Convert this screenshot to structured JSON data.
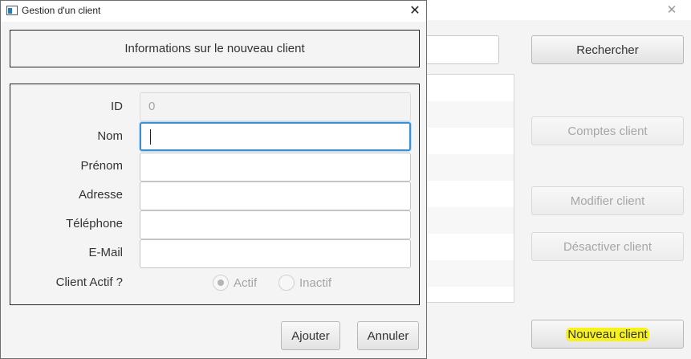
{
  "main_window": {
    "buttons": {
      "search": "Rechercher",
      "accounts": "Comptes client",
      "modify": "Modifier client",
      "deactivate": "Désactiver client",
      "new_client": "Nouveau client"
    },
    "close_icon": "✕"
  },
  "dialog": {
    "title": "Gestion d'un client",
    "close_icon": "✕",
    "header": "Informations sur le nouveau client",
    "fields": {
      "id_label": "ID",
      "id_value": "0",
      "nom_label": "Nom",
      "nom_value": "",
      "prenom_label": "Prénom",
      "prenom_value": "",
      "adresse_label": "Adresse",
      "adresse_value": "",
      "telephone_label": "Téléphone",
      "telephone_value": "",
      "email_label": "E-Mail",
      "email_value": "",
      "actif_label": "Client Actif ?"
    },
    "radios": {
      "actif": "Actif",
      "inactif": "Inactif",
      "selected": "Actif"
    },
    "buttons": {
      "add": "Ajouter",
      "cancel": "Annuler"
    }
  },
  "colors": {
    "highlight": "#f7f21d",
    "focus": "#3a90d6"
  }
}
